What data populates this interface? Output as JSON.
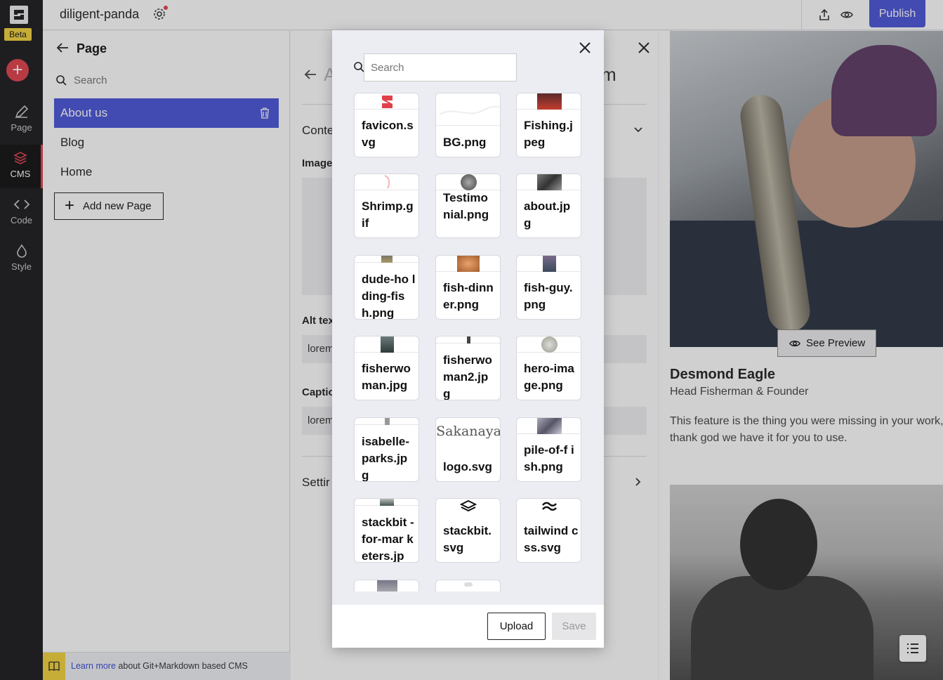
{
  "app": {
    "project_name": "diligent-panda",
    "beta_label": "Beta"
  },
  "rail": {
    "items": [
      {
        "label": "Page",
        "icon": "pencil-icon"
      },
      {
        "label": "CMS",
        "icon": "layers-icon"
      },
      {
        "label": "Code",
        "icon": "code-icon"
      },
      {
        "label": "Style",
        "icon": "drop-icon"
      }
    ]
  },
  "topbar": {
    "publish_label": "Publish"
  },
  "page_panel": {
    "title": "Page",
    "search_placeholder": "Search",
    "items": [
      {
        "label": "About us",
        "active": true
      },
      {
        "label": "Blog",
        "active": false
      },
      {
        "label": "Home",
        "active": false
      }
    ],
    "add_label": "Add new Page"
  },
  "learn_bar": {
    "link": "Learn more",
    "text": " about Git+Markdown based CMS"
  },
  "editor": {
    "title_fragment": "A",
    "title_tail": "m",
    "content_section": "Conte",
    "image_label": "Image",
    "alt_label": "Alt tex",
    "alt_value": "lorem",
    "caption_label": "Captio",
    "caption_value": "lorem",
    "settings_section": "Settir"
  },
  "preview": {
    "see_preview_label": "See Preview",
    "name": "Desmond Eagle",
    "role": "Head Fisherman & Founder",
    "description": "This feature is the thing you were missing in your work, thank god we have it for you to use."
  },
  "modal": {
    "search_placeholder": "Search",
    "files": [
      {
        "name": "favicon.svg",
        "display": "favicon.s vg"
      },
      {
        "name": "BG.png",
        "display": "BG.png"
      },
      {
        "name": "Fishing.jpeg",
        "display": "Fishing.j peg"
      },
      {
        "name": "Shrimp.gif",
        "display": "Shrimp.g if"
      },
      {
        "name": "Testimonial.png",
        "display": "Testimo nial.png"
      },
      {
        "name": "about.jpg",
        "display": "about.jp g"
      },
      {
        "name": "dude-holding-fish.png",
        "display": "dude-ho lding-fis h.png"
      },
      {
        "name": "fish-dinner.png",
        "display": "fish-dinn er.png"
      },
      {
        "name": "fish-guy.png",
        "display": "fish-guy. png"
      },
      {
        "name": "fisherwoman.jpg",
        "display": "fisherwo man.jpg"
      },
      {
        "name": "fisherwoman2.jpg",
        "display": "fisherwo man2.jp g"
      },
      {
        "name": "hero-image.png",
        "display": "hero-ima ge.png"
      },
      {
        "name": "isabelle-parks.jpg",
        "display": "isabelle- parks.jp g"
      },
      {
        "name": "logo.svg",
        "display": "logo.svg",
        "thumb_text": "Sakanaya"
      },
      {
        "name": "pile-of-fish.png",
        "display": "pile-of-f ish.png"
      },
      {
        "name": "stackbit-for-marketers.jpg",
        "display": "stackbit -for-mar keters.jp"
      },
      {
        "name": "stackbit.svg",
        "display": "stackbit. svg"
      },
      {
        "name": "tailwindcss.svg",
        "display": "tailwind css.svg"
      }
    ],
    "upload_label": "Upload",
    "save_label": "Save"
  },
  "colors": {
    "accent": "#4a55d6",
    "brand_red": "#e0414b",
    "beta_yellow": "#f3d23c"
  }
}
